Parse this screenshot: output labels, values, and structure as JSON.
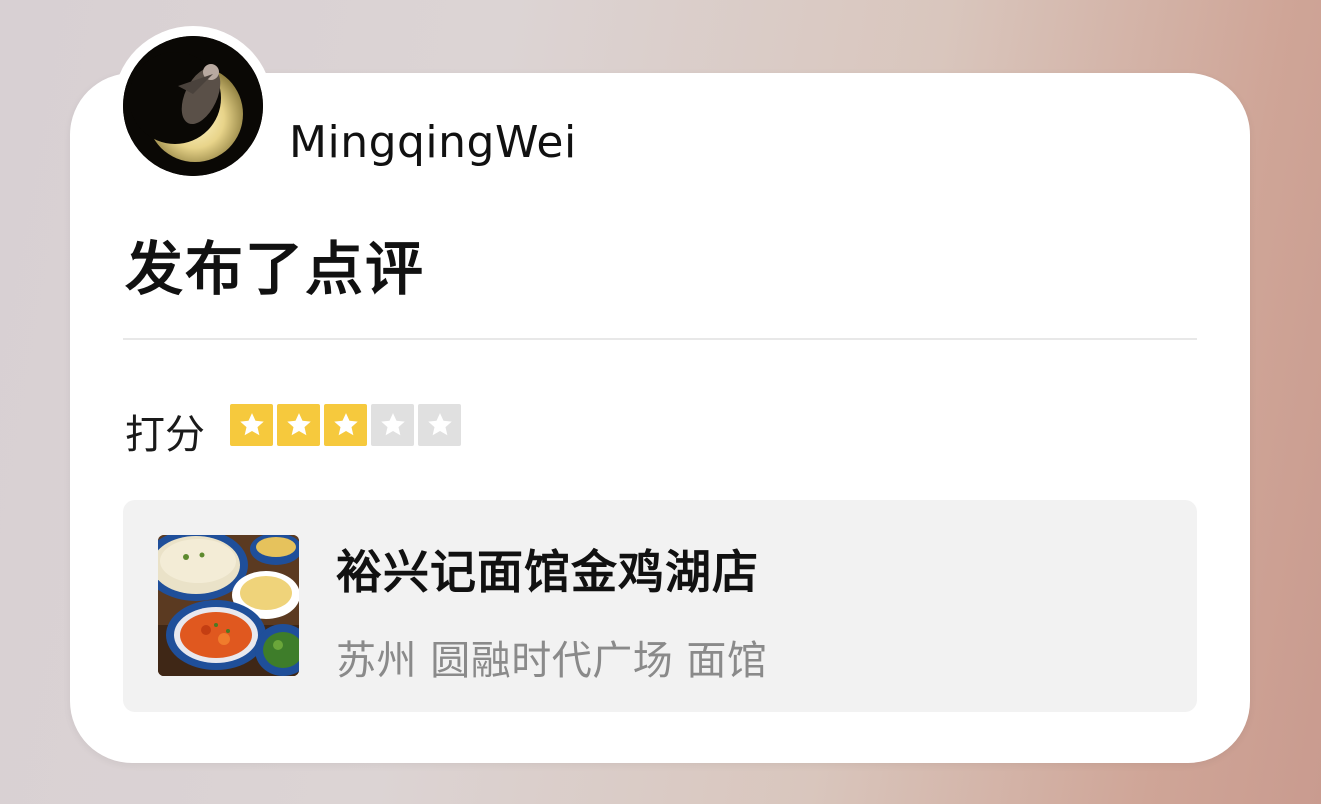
{
  "post": {
    "username": "MingqingWei",
    "action_title": "发布了点评"
  },
  "rating": {
    "label": "打分",
    "score": 3,
    "max": 5,
    "star_filled_color": "#f6c93d",
    "star_empty_color": "#e0e0e0"
  },
  "shop": {
    "name": "裕兴记面馆金鸡湖店",
    "meta": "苏州 圆融时代广场 面馆"
  },
  "icons": {
    "avatar": "crescent-moon-avatar",
    "star": "star-icon",
    "thumbnail": "noodle-dishes-photo"
  }
}
